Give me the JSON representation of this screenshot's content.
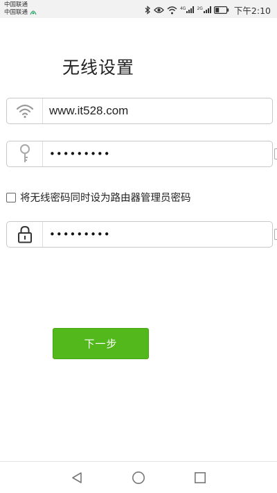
{
  "status_bar": {
    "carrier_1": "中国联通",
    "carrier_2": "中国联通",
    "network_label_1": "4G",
    "network_label_2": "2G",
    "time": "下午2:10",
    "icons": [
      "bluetooth-icon",
      "eye-icon",
      "wifi-icon",
      "signal-icon",
      "battery-icon"
    ]
  },
  "title": "无线设置",
  "wifi_name_field": {
    "icon": "wifi-icon",
    "value": "www.it528.com"
  },
  "wifi_password_field": {
    "icon": "key-icon",
    "value": "•••••••••"
  },
  "same_password_checkbox": {
    "checked": false,
    "label": "将无线密码同时设为路由器管理员密码"
  },
  "admin_password_field": {
    "icon": "lock-icon",
    "value": "•••••••••"
  },
  "next_button": {
    "label": "下一步",
    "color": "#52b81c"
  },
  "nav_bar": {
    "buttons": [
      "back-icon",
      "home-icon",
      "recents-icon"
    ]
  }
}
